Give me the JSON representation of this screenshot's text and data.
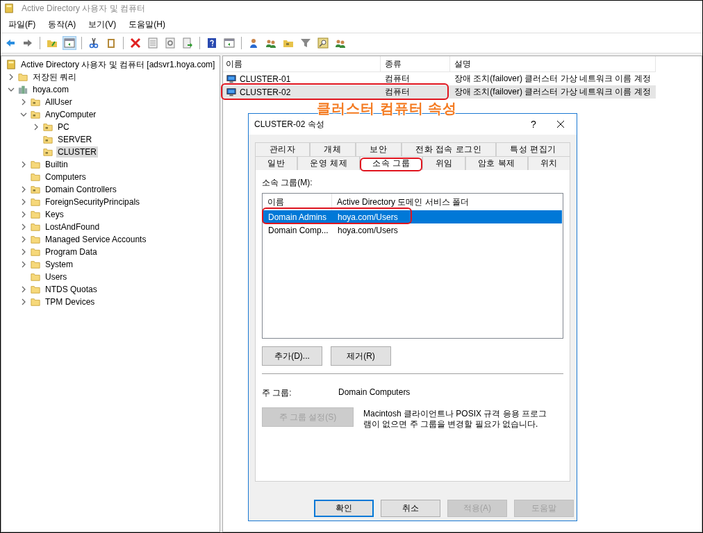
{
  "window": {
    "title": "Active Directory 사용자 및 컴퓨터"
  },
  "menu": [
    "파일(F)",
    "동작(A)",
    "보기(V)",
    "도움말(H)"
  ],
  "toolbar": [
    {
      "kind": "back",
      "pressed": false
    },
    {
      "kind": "forward",
      "pressed": false
    },
    {
      "kind": "separator"
    },
    {
      "kind": "folder-up",
      "pressed": false
    },
    {
      "kind": "pane",
      "pressed": true
    },
    {
      "kind": "separator"
    },
    {
      "kind": "cut",
      "pressed": false
    },
    {
      "kind": "clipboard",
      "pressed": false
    },
    {
      "kind": "separator"
    },
    {
      "kind": "delete",
      "pressed": false
    },
    {
      "kind": "properties",
      "pressed": false
    },
    {
      "kind": "refresh",
      "pressed": false
    },
    {
      "kind": "export",
      "pressed": false
    },
    {
      "kind": "separator"
    },
    {
      "kind": "help",
      "pressed": false
    },
    {
      "kind": "pane",
      "pressed": false
    },
    {
      "kind": "separator"
    },
    {
      "kind": "user",
      "pressed": false
    },
    {
      "kind": "group",
      "pressed": false
    },
    {
      "kind": "ou",
      "pressed": false
    },
    {
      "kind": "filter",
      "pressed": false
    },
    {
      "kind": "find",
      "pressed": false
    },
    {
      "kind": "group",
      "pressed": false
    }
  ],
  "tree": {
    "items": [
      {
        "label": "Active Directory 사용자 및 컴퓨터 [adsvr1.hoya.com]",
        "kind": "snapin",
        "selected": false,
        "children": [
          {
            "label": "저장된 쿼리",
            "kind": "folder",
            "selected": false,
            "expanded": false
          },
          {
            "label": "hoya.com",
            "kind": "domain",
            "selected": false,
            "expanded": true,
            "children": [
              {
                "label": "AllUser",
                "kind": "ou",
                "selected": false,
                "expanded": false
              },
              {
                "label": "AnyComputer",
                "kind": "ou",
                "selected": false,
                "expanded": true,
                "children": [
                  {
                    "label": "PC",
                    "kind": "ou",
                    "selected": false,
                    "expanded": false
                  },
                  {
                    "label": "SERVER",
                    "kind": "ou",
                    "selected": false
                  },
                  {
                    "label": "CLUSTER",
                    "kind": "ou",
                    "selected": true
                  }
                ]
              },
              {
                "label": "Builtin",
                "kind": "folder",
                "selected": false,
                "expanded": false
              },
              {
                "label": "Computers",
                "kind": "folder",
                "selected": false
              },
              {
                "label": "Domain Controllers",
                "kind": "ou",
                "selected": false,
                "expanded": false
              },
              {
                "label": "ForeignSecurityPrincipals",
                "kind": "folder",
                "selected": false,
                "expanded": false
              },
              {
                "label": "Keys",
                "kind": "folder",
                "selected": false,
                "expanded": false
              },
              {
                "label": "LostAndFound",
                "kind": "folder",
                "selected": false,
                "expanded": false
              },
              {
                "label": "Managed Service Accounts",
                "kind": "folder",
                "selected": false,
                "expanded": false
              },
              {
                "label": "Program Data",
                "kind": "folder",
                "selected": false,
                "expanded": false
              },
              {
                "label": "System",
                "kind": "folder",
                "selected": false,
                "expanded": false
              },
              {
                "label": "Users",
                "kind": "folder",
                "selected": false
              },
              {
                "label": "NTDS Quotas",
                "kind": "folder",
                "selected": false,
                "expanded": false
              },
              {
                "label": "TPM Devices",
                "kind": "folder",
                "selected": false,
                "expanded": false
              }
            ]
          }
        ]
      }
    ]
  },
  "list": {
    "columns": [
      "이름",
      "종류",
      "설명"
    ],
    "rows": [
      {
        "cells": [
          "CLUSTER-01",
          "컴퓨터",
          "장애 조치(failover) 클러스터 가상 네트워크 이름 계정"
        ],
        "selected": false,
        "highlighted": false
      },
      {
        "cells": [
          "CLUSTER-02",
          "컴퓨터",
          "장애 조치(failover) 클러스터 가상 네트워크 이름 계정"
        ],
        "selected": true,
        "highlighted": true
      }
    ]
  },
  "annotation": {
    "caption": "클러스터 컴퓨터 속성"
  },
  "dialog": {
    "title": "CLUSTER-02 속성",
    "help_button": "?",
    "tab_rows": [
      [
        {
          "label": "관리자",
          "selected": false,
          "highlighted": false
        },
        {
          "label": "개체",
          "selected": false,
          "highlighted": false
        },
        {
          "label": "보안",
          "selected": false,
          "highlighted": false
        },
        {
          "label": "전화 접속 로그인",
          "selected": false,
          "highlighted": false
        },
        {
          "label": "특성 편집기",
          "selected": false,
          "highlighted": false
        }
      ],
      [
        {
          "label": "일반",
          "selected": false,
          "highlighted": false
        },
        {
          "label": "운영 체제",
          "selected": false,
          "highlighted": false
        },
        {
          "label": "소속 그룹",
          "selected": true,
          "highlighted": true
        },
        {
          "label": "위임",
          "selected": false,
          "highlighted": false
        },
        {
          "label": "암호 복제",
          "selected": false,
          "highlighted": false
        },
        {
          "label": "위치",
          "selected": false,
          "highlighted": false
        }
      ]
    ],
    "members_label": "소속 그룹(M):",
    "members": {
      "columns": [
        "이름",
        "Active Directory 도메인 서비스 폴더"
      ],
      "rows": [
        {
          "cells": [
            "Domain Admins",
            "hoya.com/Users"
          ],
          "selected": true,
          "highlighted": true
        },
        {
          "cells": [
            "Domain Comp...",
            "hoya.com/Users"
          ],
          "selected": false,
          "highlighted": false
        }
      ]
    },
    "member_buttons": [
      {
        "label": "추가(D)...",
        "disabled": false
      },
      {
        "label": "제거(R)",
        "disabled": false
      }
    ],
    "primary_group": {
      "label": "주 그룹:",
      "value": "Domain Computers"
    },
    "set_primary": {
      "label": "주 그룹 설정(S)",
      "disabled": true
    },
    "note": "Macintosh 클라이언트나 POSIX 규격 응용 프로그램이 없으면 주 그룹을 변경할 필요가 없습니다.",
    "buttons": [
      {
        "label": "확인",
        "disabled": false,
        "default": true
      },
      {
        "label": "취소",
        "disabled": false,
        "default": false
      },
      {
        "label": "적용(A)",
        "disabled": true,
        "default": false
      },
      {
        "label": "도움말",
        "disabled": true,
        "default": false
      }
    ]
  }
}
